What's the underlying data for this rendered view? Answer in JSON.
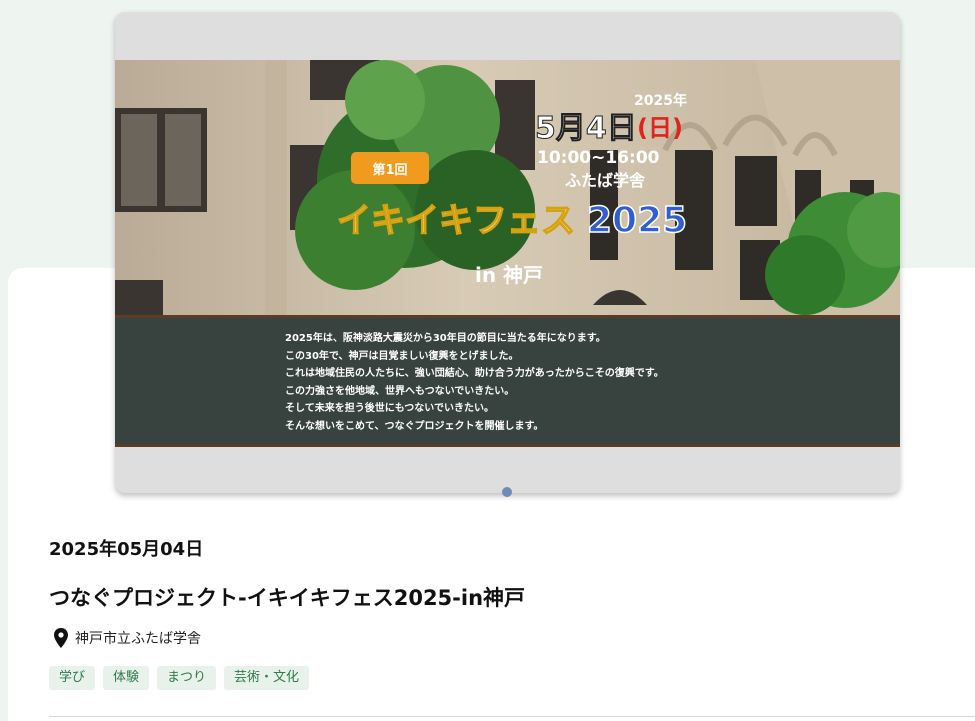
{
  "banner": {
    "year": "2025年",
    "month_day": "5月4日",
    "weekday": "(日)",
    "time": "10:00~16:00",
    "venue": "ふたば学舎",
    "edition": "第1回",
    "fest_name": "イキイキフェス",
    "fest_year": "2025",
    "city": "in 神戸",
    "lines": [
      "2025年は、阪神淡路大震災から30年目の節目に当たる年になります。",
      "この30年で、神戸は目覚ましい復興をとげました。",
      "これは地域住民の人たちに、強い団結心、助け合う力があったからこその復興です。",
      "この力強さを他地域、世界へもつないでいきたい。",
      "そして未来を担う後世にもつないでいきたい。",
      "そんな想いをこめて、つなぐプロジェクトを開催します。"
    ]
  },
  "event": {
    "date": "2025年05月04日",
    "title": "つなぐプロジェクト-イキイキフェス2025-in神戸",
    "location": "神戸市立ふたば学舎",
    "tags": [
      "学び",
      "体験",
      "まつり",
      "芸術・文化"
    ]
  },
  "colors": {
    "accent_green": "#2e7a4a",
    "tag_bg": "#e8f2ea",
    "dot": "#6f8bb8"
  }
}
